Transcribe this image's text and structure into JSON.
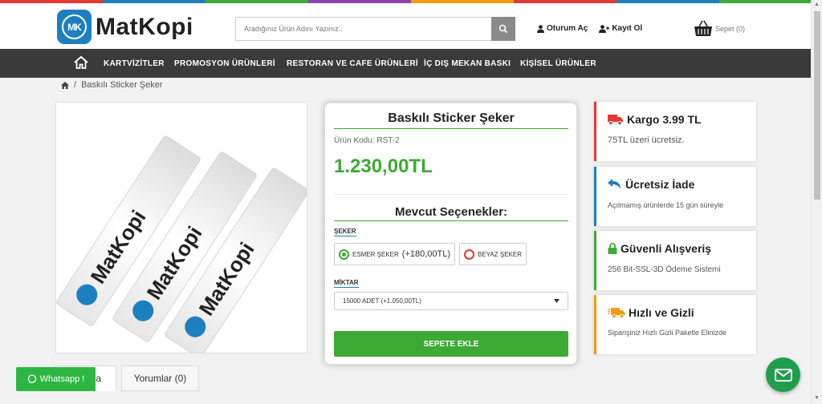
{
  "colors": {
    "accent_green": "#3daa35",
    "brand_blue": "#1d7fc0",
    "nav_bg": "#3a3a3a",
    "strip": [
      "#e53935",
      "#1d7fc0",
      "#3daa35",
      "#8e44ad",
      "#f39c12",
      "#e53935",
      "#1d7fc0",
      "#3daa35"
    ]
  },
  "header": {
    "logo_badge": "MK",
    "logo_text": "MatKopi",
    "search_placeholder": "Aradığınız Ürün Adını Yazınız..",
    "login": "Oturum Aç",
    "register": "Kayıt Ol",
    "cart": "Sepet (0)"
  },
  "nav": {
    "items": [
      "KARTVİZİTLER",
      "PROMOSYON ÜRÜNLERİ",
      "RESTORAN VE CAFE ÜRÜNLERİ",
      "İÇ DIŞ MEKAN BASKI",
      "KİŞİSEL ÜRÜNLER"
    ]
  },
  "breadcrumb": {
    "separator": "/",
    "current": "Baskılı Sticker Şeker"
  },
  "product": {
    "title": "Baskılı Sticker Şeker",
    "code": "Ürün Kodu: RST-2",
    "price": "1.230,00TL",
    "options_title": "Mevcut Seçenekler:",
    "sugar_label": "ŞEKER",
    "option1_name": "ESMER ŞEKER",
    "option1_extra": "(+180,00TL)",
    "option2_name": "BEYAZ ŞEKER",
    "qty_label": "MİKTAR",
    "qty_selected": "15000 ADET (+1.050,00TL)",
    "add_to_cart": "SEPETE EKLE"
  },
  "image_text": "MatKopi",
  "tabs": {
    "tab1": "ma",
    "tab2": "Yorumlar (0)"
  },
  "whatsapp": "Whatsapp !",
  "info": [
    {
      "title": "Kargo 3.99 TL",
      "sub": "75TL üzeri ücretsiz.",
      "color": "#e53935"
    },
    {
      "title": "Ücretsiz İade",
      "sub": "Açılmamış ürünlerde 15 gün süreyle",
      "color": "#1d7fc0"
    },
    {
      "title": "Güvenli Alışveriş",
      "sub": "256 Bit-SSL-3D Ödeme Sistemi",
      "color": "#3daa35"
    },
    {
      "title": "Hızlı ve Gizli",
      "sub": "Siparişiniz Hızlı Gizli Paketle Elinizde",
      "color": "#f39c12"
    }
  ]
}
